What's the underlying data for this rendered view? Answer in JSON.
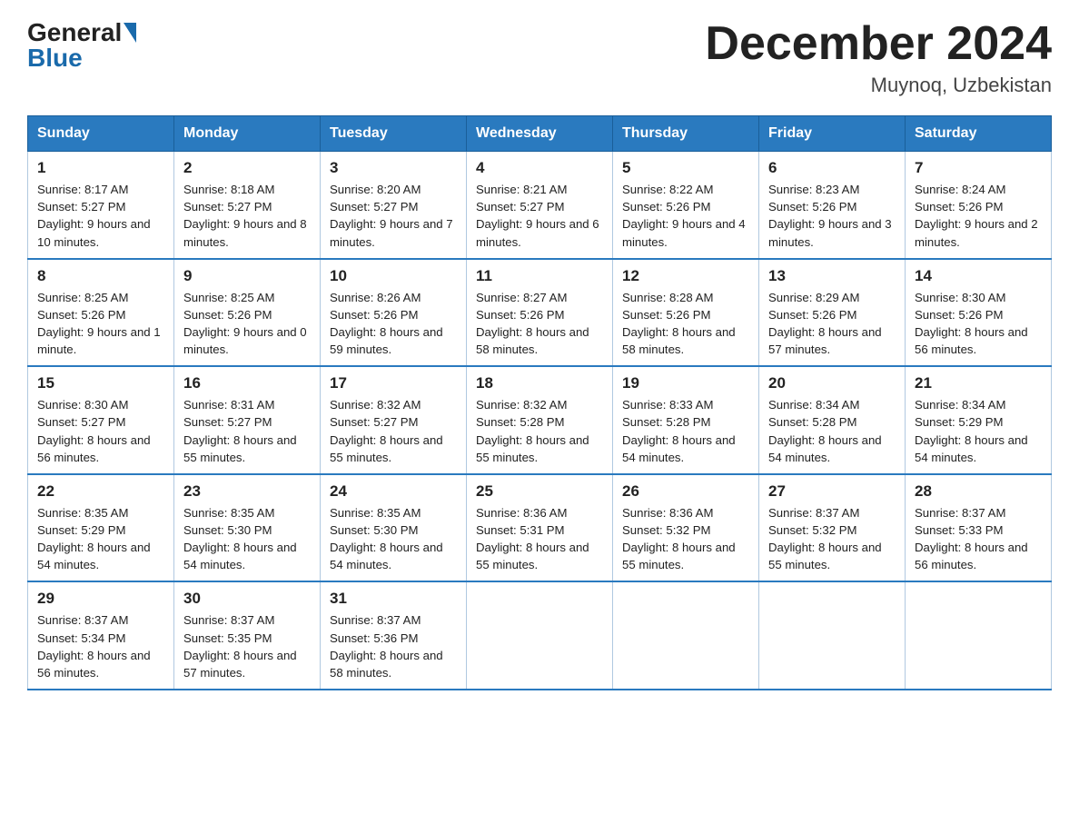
{
  "header": {
    "logo_general": "General",
    "logo_blue": "Blue",
    "month_title": "December 2024",
    "location": "Muynoq, Uzbekistan"
  },
  "weekdays": [
    "Sunday",
    "Monday",
    "Tuesday",
    "Wednesday",
    "Thursday",
    "Friday",
    "Saturday"
  ],
  "weeks": [
    [
      {
        "day": "1",
        "sunrise": "8:17 AM",
        "sunset": "5:27 PM",
        "daylight": "9 hours and 10 minutes."
      },
      {
        "day": "2",
        "sunrise": "8:18 AM",
        "sunset": "5:27 PM",
        "daylight": "9 hours and 8 minutes."
      },
      {
        "day": "3",
        "sunrise": "8:20 AM",
        "sunset": "5:27 PM",
        "daylight": "9 hours and 7 minutes."
      },
      {
        "day": "4",
        "sunrise": "8:21 AM",
        "sunset": "5:27 PM",
        "daylight": "9 hours and 6 minutes."
      },
      {
        "day": "5",
        "sunrise": "8:22 AM",
        "sunset": "5:26 PM",
        "daylight": "9 hours and 4 minutes."
      },
      {
        "day": "6",
        "sunrise": "8:23 AM",
        "sunset": "5:26 PM",
        "daylight": "9 hours and 3 minutes."
      },
      {
        "day": "7",
        "sunrise": "8:24 AM",
        "sunset": "5:26 PM",
        "daylight": "9 hours and 2 minutes."
      }
    ],
    [
      {
        "day": "8",
        "sunrise": "8:25 AM",
        "sunset": "5:26 PM",
        "daylight": "9 hours and 1 minute."
      },
      {
        "day": "9",
        "sunrise": "8:25 AM",
        "sunset": "5:26 PM",
        "daylight": "9 hours and 0 minutes."
      },
      {
        "day": "10",
        "sunrise": "8:26 AM",
        "sunset": "5:26 PM",
        "daylight": "8 hours and 59 minutes."
      },
      {
        "day": "11",
        "sunrise": "8:27 AM",
        "sunset": "5:26 PM",
        "daylight": "8 hours and 58 minutes."
      },
      {
        "day": "12",
        "sunrise": "8:28 AM",
        "sunset": "5:26 PM",
        "daylight": "8 hours and 58 minutes."
      },
      {
        "day": "13",
        "sunrise": "8:29 AM",
        "sunset": "5:26 PM",
        "daylight": "8 hours and 57 minutes."
      },
      {
        "day": "14",
        "sunrise": "8:30 AM",
        "sunset": "5:26 PM",
        "daylight": "8 hours and 56 minutes."
      }
    ],
    [
      {
        "day": "15",
        "sunrise": "8:30 AM",
        "sunset": "5:27 PM",
        "daylight": "8 hours and 56 minutes."
      },
      {
        "day": "16",
        "sunrise": "8:31 AM",
        "sunset": "5:27 PM",
        "daylight": "8 hours and 55 minutes."
      },
      {
        "day": "17",
        "sunrise": "8:32 AM",
        "sunset": "5:27 PM",
        "daylight": "8 hours and 55 minutes."
      },
      {
        "day": "18",
        "sunrise": "8:32 AM",
        "sunset": "5:28 PM",
        "daylight": "8 hours and 55 minutes."
      },
      {
        "day": "19",
        "sunrise": "8:33 AM",
        "sunset": "5:28 PM",
        "daylight": "8 hours and 54 minutes."
      },
      {
        "day": "20",
        "sunrise": "8:34 AM",
        "sunset": "5:28 PM",
        "daylight": "8 hours and 54 minutes."
      },
      {
        "day": "21",
        "sunrise": "8:34 AM",
        "sunset": "5:29 PM",
        "daylight": "8 hours and 54 minutes."
      }
    ],
    [
      {
        "day": "22",
        "sunrise": "8:35 AM",
        "sunset": "5:29 PM",
        "daylight": "8 hours and 54 minutes."
      },
      {
        "day": "23",
        "sunrise": "8:35 AM",
        "sunset": "5:30 PM",
        "daylight": "8 hours and 54 minutes."
      },
      {
        "day": "24",
        "sunrise": "8:35 AM",
        "sunset": "5:30 PM",
        "daylight": "8 hours and 54 minutes."
      },
      {
        "day": "25",
        "sunrise": "8:36 AM",
        "sunset": "5:31 PM",
        "daylight": "8 hours and 55 minutes."
      },
      {
        "day": "26",
        "sunrise": "8:36 AM",
        "sunset": "5:32 PM",
        "daylight": "8 hours and 55 minutes."
      },
      {
        "day": "27",
        "sunrise": "8:37 AM",
        "sunset": "5:32 PM",
        "daylight": "8 hours and 55 minutes."
      },
      {
        "day": "28",
        "sunrise": "8:37 AM",
        "sunset": "5:33 PM",
        "daylight": "8 hours and 56 minutes."
      }
    ],
    [
      {
        "day": "29",
        "sunrise": "8:37 AM",
        "sunset": "5:34 PM",
        "daylight": "8 hours and 56 minutes."
      },
      {
        "day": "30",
        "sunrise": "8:37 AM",
        "sunset": "5:35 PM",
        "daylight": "8 hours and 57 minutes."
      },
      {
        "day": "31",
        "sunrise": "8:37 AM",
        "sunset": "5:36 PM",
        "daylight": "8 hours and 58 minutes."
      },
      null,
      null,
      null,
      null
    ]
  ]
}
